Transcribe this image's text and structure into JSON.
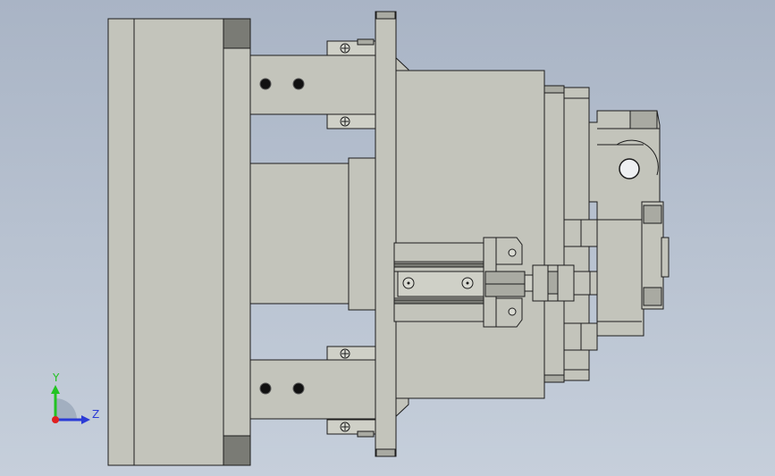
{
  "view": {
    "background_top": "#a9b4c5",
    "background_bottom": "#c6cfdb",
    "part_color": "#c3c4bb",
    "edge_color": "#1c1c1c"
  },
  "triad": {
    "y_label": "Y",
    "z_label": "Z",
    "y_color": "#22c322",
    "z_color": "#2b3bd6",
    "x_color": "#e02020"
  }
}
